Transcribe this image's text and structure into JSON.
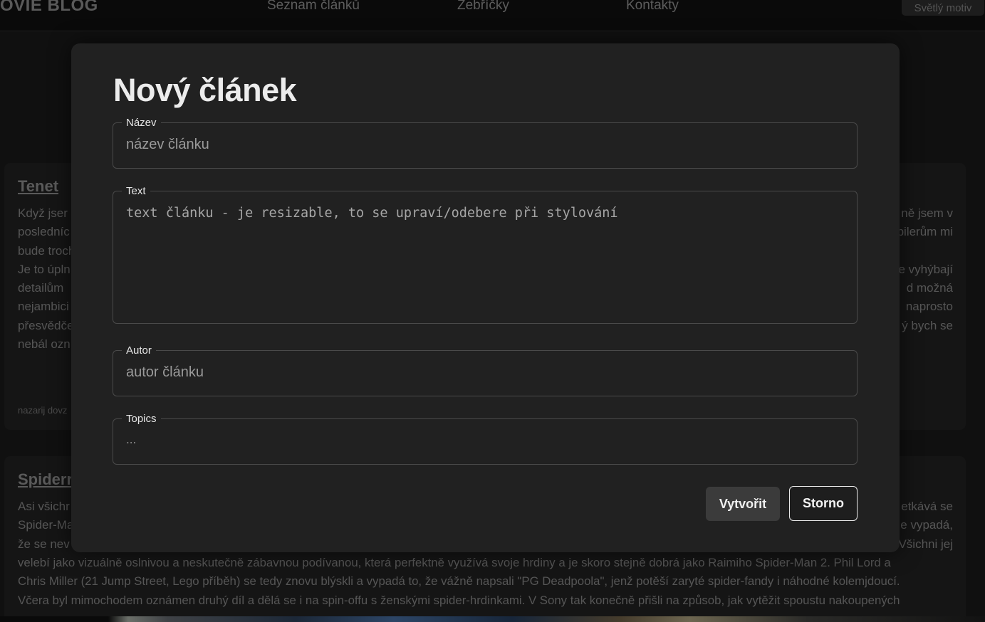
{
  "header": {
    "brand": "OVIE BLOG",
    "nav": [
      "Seznam článků",
      "Žebříčky",
      "Kontakty"
    ],
    "theme_button": "Světlý motiv"
  },
  "articles": [
    {
      "title": "Tenet",
      "left_lines": [
        "Když jser",
        "posledníc",
        "bude troch",
        "Je to úpln",
        "detailům",
        "nejambici",
        "přesvědče",
        "nebál ozn"
      ],
      "right_lines": [
        "ně jsem v",
        "pilerům mi",
        "",
        "e vyhýbají",
        "d možná",
        "naprosto",
        "ý bych se",
        ""
      ],
      "meta": "nazarij dovz"
    },
    {
      "title": "Spiderr",
      "left_lines": [
        "Asi všichr",
        "Spider-Ma",
        "že se nev"
      ],
      "right_lines": [
        "etkává se",
        "e vypadá,",
        "Všichni jej"
      ],
      "full_lines": [
        "velebí jako vizuálně oslnivou a neskutečně zábavnou podívanou, která perfektně využívá svoje hrdiny a je skoro stejně dobrá jako Raimiho Spider-Man 2. Phil Lord a",
        "Chris Miller (21 Jump Street, Lego příběh) se tedy znovu blýskli a vypadá to, že vážně napsali \"PG Deadpoola\", jenž potěší zaryté spider-fandy i náhodné kolemjdoucí.",
        "Včera byl mimochodem oznámen druhý díl a dělá se i na spin-offu s ženskými spider-hrdinkami. V Sony tak konečně přišli na způsob, jak vytěžit spoustu nakoupených"
      ]
    }
  ],
  "modal": {
    "title": "Nový článek",
    "fields": {
      "name": {
        "label": "Název",
        "placeholder": "název článku"
      },
      "text": {
        "label": "Text",
        "placeholder": "text článku - je resizable, to se upraví/odebere při stylování"
      },
      "author": {
        "label": "Autor",
        "placeholder": "autor článku"
      },
      "topics": {
        "label": "Topics",
        "placeholder": "..."
      }
    },
    "create_button": "Vytvořit",
    "cancel_button": "Storno"
  }
}
